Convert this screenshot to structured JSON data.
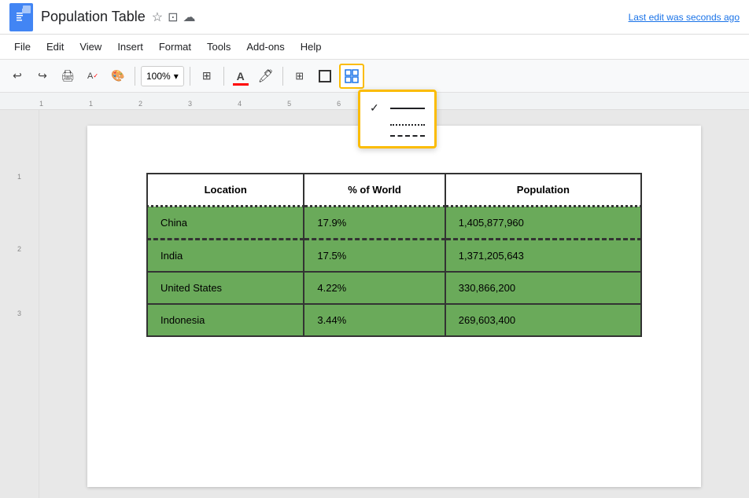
{
  "title": "Population Table",
  "title_icons": [
    "☆",
    "⊡",
    "☁"
  ],
  "last_edit": "Last edit was seconds ago",
  "menu": {
    "items": [
      "File",
      "Edit",
      "View",
      "Insert",
      "Format",
      "Tools",
      "Add-ons",
      "Help"
    ]
  },
  "toolbar": {
    "zoom": "100%",
    "border_style_active_label": "border-style",
    "border_options": [
      {
        "style": "solid",
        "selected": true
      },
      {
        "style": "dotted",
        "selected": false
      },
      {
        "style": "dashed",
        "selected": false
      }
    ]
  },
  "table": {
    "headers": [
      "Location",
      "% of World",
      "Population"
    ],
    "rows": [
      {
        "location": "China",
        "percent": "17.9%",
        "population": "1,405,877,960",
        "border_top": "dotted"
      },
      {
        "location": "India",
        "percent": "17.5%",
        "population": "1,371,205,643",
        "border_top": "dashed"
      },
      {
        "location": "United States",
        "percent": "4.22%",
        "population": "330,866,200",
        "border_top": "solid"
      },
      {
        "location": "Indonesia",
        "percent": "3.44%",
        "population": "269,603,400",
        "border_top": "solid"
      }
    ]
  }
}
